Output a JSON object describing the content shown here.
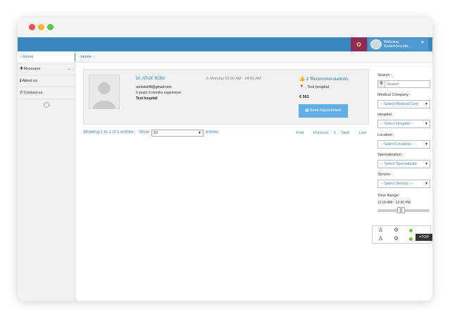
{
  "header": {
    "welcome_line1": "Welcome,",
    "welcome_line2": "SystemSecreta..."
  },
  "sidebar": {
    "items": [
      {
        "label": "Home"
      },
      {
        "label": "Resource"
      },
      {
        "label": "About us"
      },
      {
        "label": "Contact us"
      }
    ]
  },
  "breadcrumb": {
    "home": "Home",
    "separator": "›"
  },
  "doctor": {
    "name": "Dr. ATUK SONI",
    "email": "soniatul48@gmail.com",
    "experience": "0 years 0 months experience",
    "hospital": "Test hospital",
    "schedule": "Monday 02:00 AM - 04:00 AM",
    "recommendations": "2 Recommendations",
    "location": ", Test hospital",
    "price": "€ 562",
    "book_label": "Book Appointment"
  },
  "table_info": {
    "showing": "Showing 1 to 1 of 1 entries",
    "show_label": "Show",
    "entries_value": "10",
    "entries_label": "entries"
  },
  "pagination": {
    "first": "First",
    "previous": "Previous",
    "current": "1",
    "next": "Next",
    "last": "Last"
  },
  "filters": {
    "search_label": "Search :",
    "search_placeholder": "Search",
    "medical_company_label": "Medical Company :",
    "medical_company_value": "-- Select Medical Com",
    "hospital_label": "Hospital :",
    "hospital_value": "-- Select Hospital --",
    "location_label": "Location :",
    "location_value": "-- Select Location --",
    "specialization_label": "Specialization :",
    "specialization_value": "-- Select Specializatic",
    "service_label": "Service :",
    "service_value": "-- Select Service --",
    "time_range_label": "Time Range:",
    "time_range_value": "10:00 AM - 12:00 PM"
  },
  "totop_label": "=TOP",
  "colors": {
    "nav_blue": "#3a87c0",
    "book_button": "#63aee4",
    "gift_bg": "#8e2a58",
    "online_dot": "#6fbf3a"
  }
}
